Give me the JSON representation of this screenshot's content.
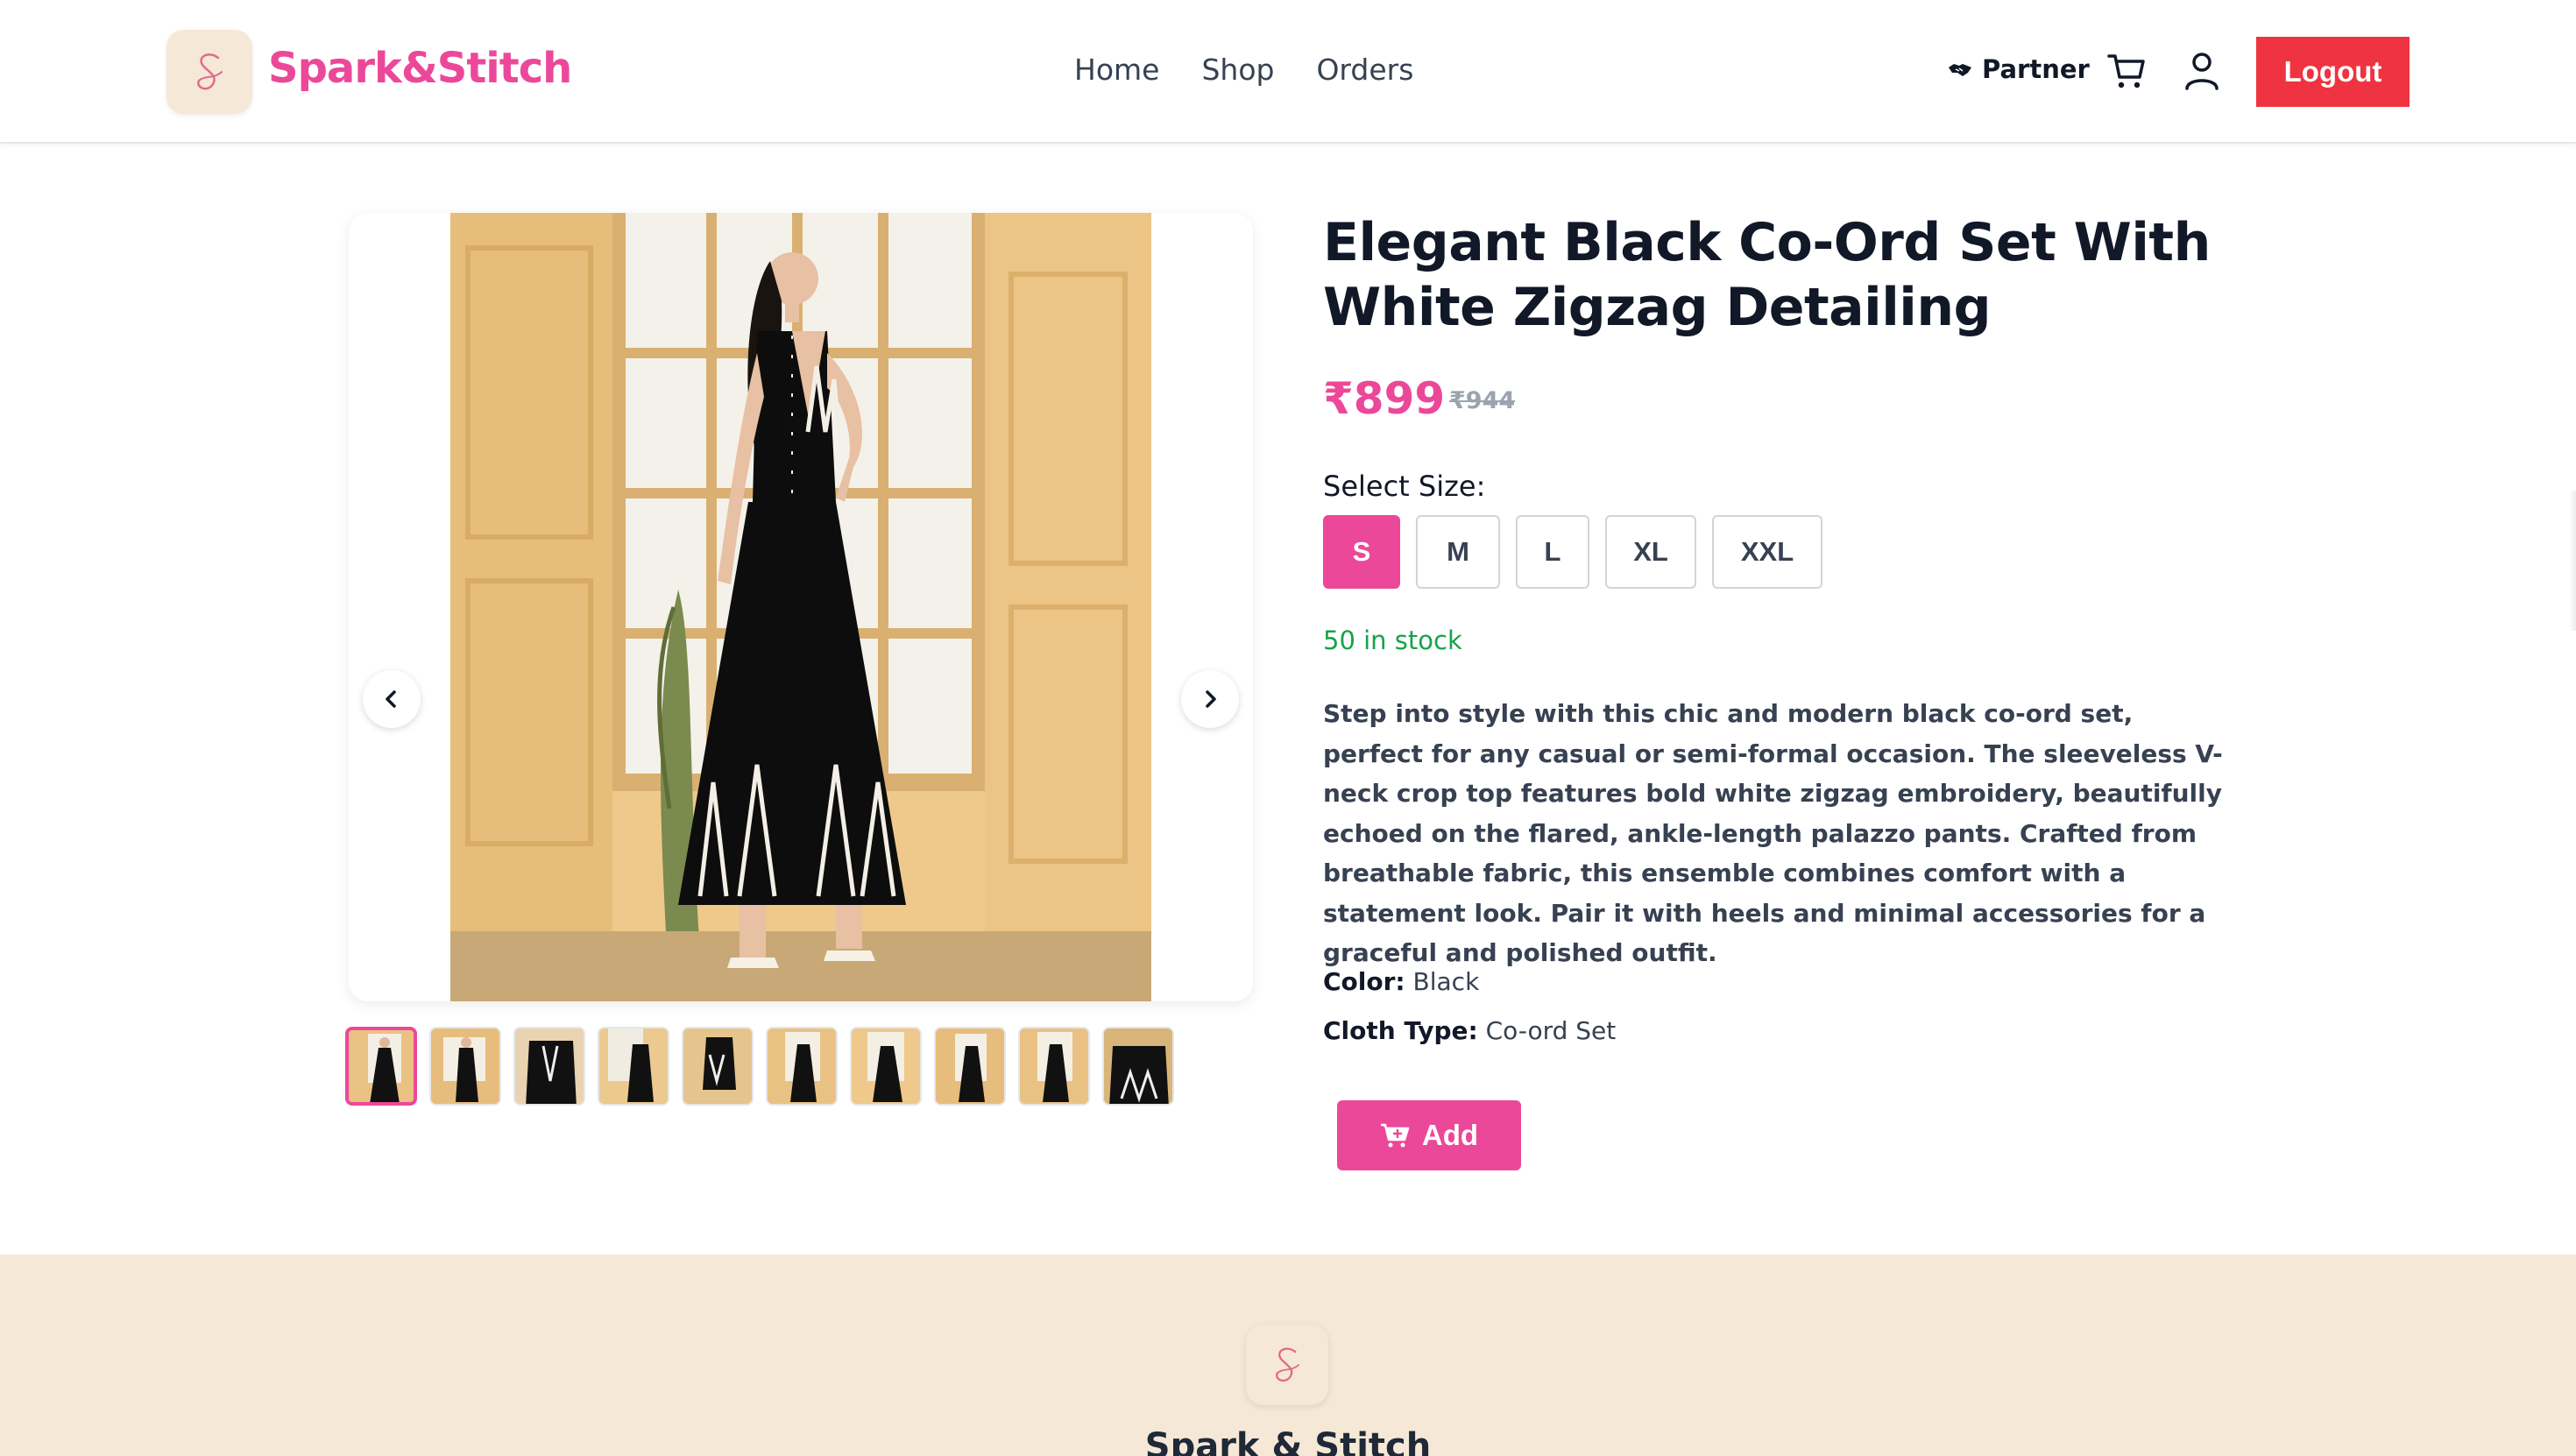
{
  "navbar": {
    "brand": "Spark&Stitch",
    "logo_letter": "S",
    "links": [
      "Home",
      "Shop",
      "Orders"
    ],
    "partner_label": "Partner",
    "logout_label": "Logout"
  },
  "product": {
    "title": "Elegant Black Co-Ord Set With White Zigzag Detailing",
    "price": "₹899",
    "old_price": "₹944",
    "size_label": "Select Size:",
    "sizes": [
      "S",
      "M",
      "L",
      "XL",
      "XXL"
    ],
    "selected_size": "S",
    "stock": "50 in stock",
    "description": "Step into style with this chic and modern black co-ord set, perfect for any casual or semi-formal occasion. The sleeveless V-neck crop top features bold white zigzag embroidery, beautifully echoed on the flared, ankle-length palazzo pants. Crafted from breathable fabric, this ensemble combines comfort with a statement look. Pair it with heels and minimal accessories for a graceful and polished outfit.",
    "color_label": "Color:",
    "color_value": "Black",
    "cloth_type_label": "Cloth Type:",
    "cloth_type_value": "Co-ord Set",
    "add_label": "Add",
    "thumbnail_count": 10,
    "active_thumbnail": 1
  },
  "footer": {
    "brand": "Spark & Stitch"
  },
  "colors": {
    "accent": "#ec4899",
    "logout": "#ef3340",
    "stock": "#16a34a",
    "footer_bg": "#f6e8d6"
  },
  "icons": [
    "handshake-icon",
    "cart-icon",
    "user-icon",
    "chevron-left-icon",
    "chevron-right-icon",
    "cart-plus-icon"
  ]
}
